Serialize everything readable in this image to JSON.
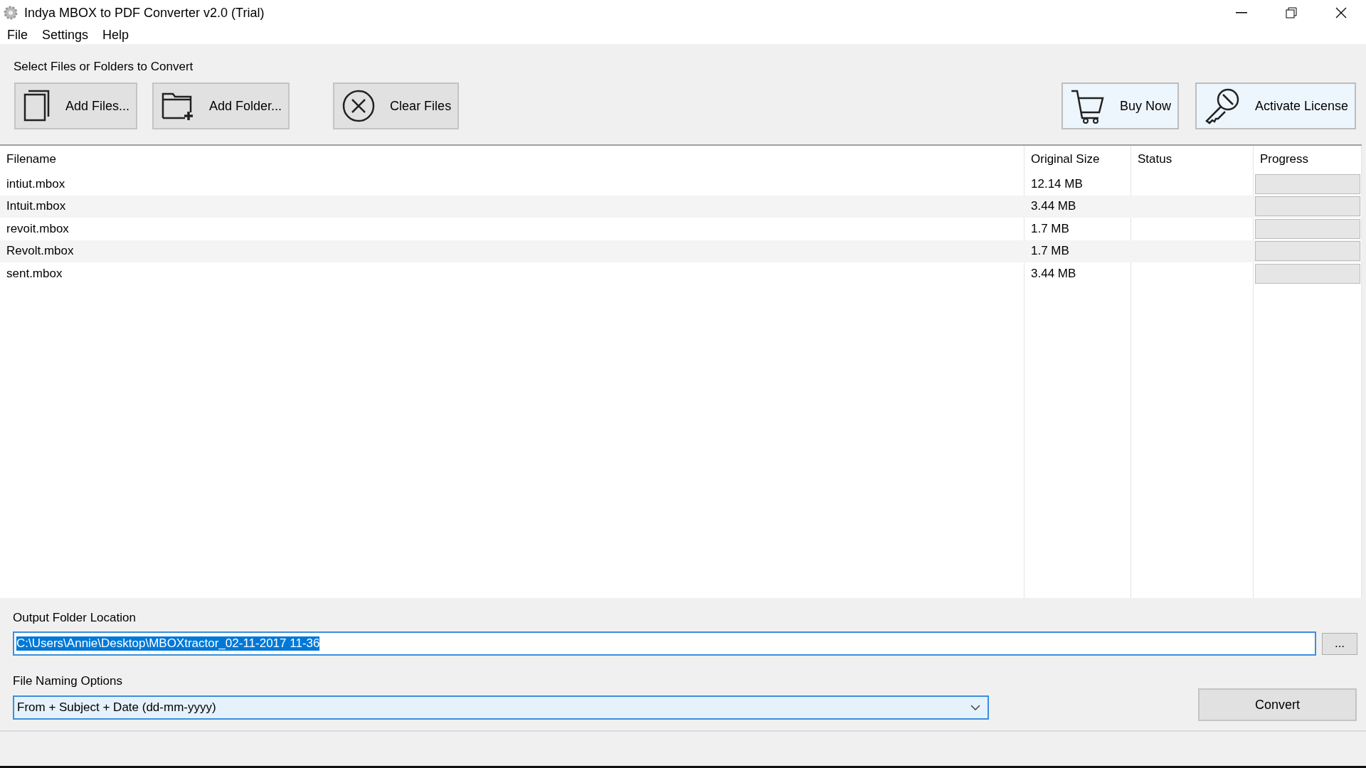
{
  "window": {
    "title": "Indya MBOX to PDF Converter v2.0 (Trial)"
  },
  "menu": [
    "File",
    "Settings",
    "Help"
  ],
  "select_label": "Select Files or Folders to Convert",
  "toolbar": {
    "left": [
      {
        "kind": "files",
        "label": "Add Files...",
        "highlighted": false
      },
      {
        "kind": "folder",
        "label": "Add Folder...",
        "highlighted": false
      },
      {
        "kind": "clear",
        "label": "Clear Files",
        "highlighted": false
      }
    ],
    "right": [
      {
        "kind": "cart",
        "label": "Buy Now",
        "highlighted": true
      },
      {
        "kind": "key",
        "label": "Activate License",
        "highlighted": true
      }
    ]
  },
  "table": {
    "columns": [
      "Filename",
      "Original Size",
      "Status",
      "Progress"
    ],
    "rows": [
      {
        "filename": "intiut.mbox",
        "size": "12.14 MB",
        "level": 0
      },
      {
        "filename": "Intuit.mbox",
        "size": "3.44 MB",
        "level": 0
      },
      {
        "filename": "revoit.mbox",
        "size": "1.7 MB",
        "level": 0
      },
      {
        "filename": "Revolt.mbox",
        "size": "1.7 MB",
        "level": 0
      },
      {
        "filename": "sent.mbox",
        "size": "3.44 MB",
        "level": 0
      }
    ]
  },
  "output": {
    "label": "Output Folder Location",
    "value": "C:\\Users\\Annie\\Desktop\\MBOXtractor_02-11-2017 11-36",
    "selected": true,
    "browse": "..."
  },
  "naming": {
    "label": "File Naming Options",
    "value": "From + Subject + Date (dd-mm-yyyy)"
  },
  "convert": "Convert"
}
